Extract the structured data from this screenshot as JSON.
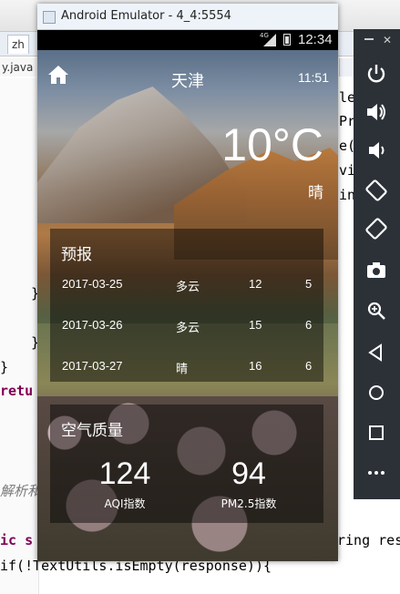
{
  "emulator": {
    "window_title": "Android Emulator - 4_4:5554",
    "status_time": "12:34",
    "status_network": "4G"
  },
  "app": {
    "city": "天津",
    "update_time": "11:51",
    "temperature": "10°C",
    "weather": "晴",
    "forecast_title": "预报",
    "forecast": [
      {
        "date": "2017-03-25",
        "cond": "多云",
        "max": "12",
        "min": "5"
      },
      {
        "date": "2017-03-26",
        "cond": "多云",
        "max": "15",
        "min": "6"
      },
      {
        "date": "2017-03-27",
        "cond": "晴",
        "max": "16",
        "min": "6"
      }
    ],
    "aqi_title": "空气质量",
    "aqi_value": "124",
    "aqi_label": "AQI指数",
    "pm25_value": "94",
    "pm25_label": "PM2.5指数"
  },
  "ide": {
    "tab_label": "zh",
    "file_tab": "y.java",
    "code_right": [
      "le",
      "Pr",
      "e(",
      "vi",
      "in"
    ],
    "code_return": "retu",
    "code_comment": "解析和",
    "code_line1_left": "ic s",
    "code_line1_right": "ring res",
    "code_line2": "if(!TextUtils.isEmpty(response)){",
    "code_braces": [
      "}",
      "}",
      "}"
    ]
  },
  "controls": {
    "icons": [
      "power-icon",
      "volume-up-icon",
      "volume-down-icon",
      "rotate-left-icon",
      "rotate-right-icon",
      "camera-icon",
      "zoom-icon",
      "back-icon",
      "home-circle-icon",
      "overview-icon",
      "more-icon"
    ]
  }
}
